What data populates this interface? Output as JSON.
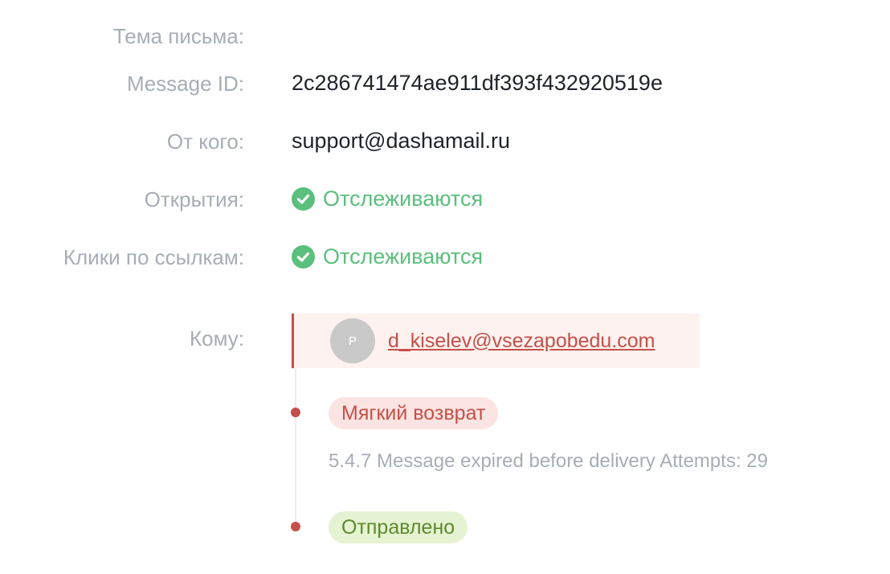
{
  "fields": {
    "subject_label": "Тема письма:",
    "message_id_label": "Message ID:",
    "message_id_value": "2c286741474ae911df393f432920519e",
    "from_label": "От кого:",
    "from_value": "support@dashamail.ru",
    "opens_label": "Открытия:",
    "opens_value": "Отслеживаются",
    "clicks_label": "Клики по ссылкам:",
    "clicks_value": "Отслеживаются",
    "to_label": "Кому:"
  },
  "recipient": {
    "avatar_initial": "P",
    "email": "d_kiselev@vsezapobedu.com"
  },
  "timeline": [
    {
      "status": "Мягкий возврат",
      "details": "5.4.7 Message expired before delivery Attempts: 29"
    },
    {
      "status": "Отправлено"
    }
  ],
  "colors": {
    "label": "#a8adb5",
    "tracked_green": "#5bbf7d",
    "bounce_red": "#c5504a",
    "sent_green": "#5b8a2a"
  },
  "icons": {
    "tracked": "check-circle-icon"
  }
}
